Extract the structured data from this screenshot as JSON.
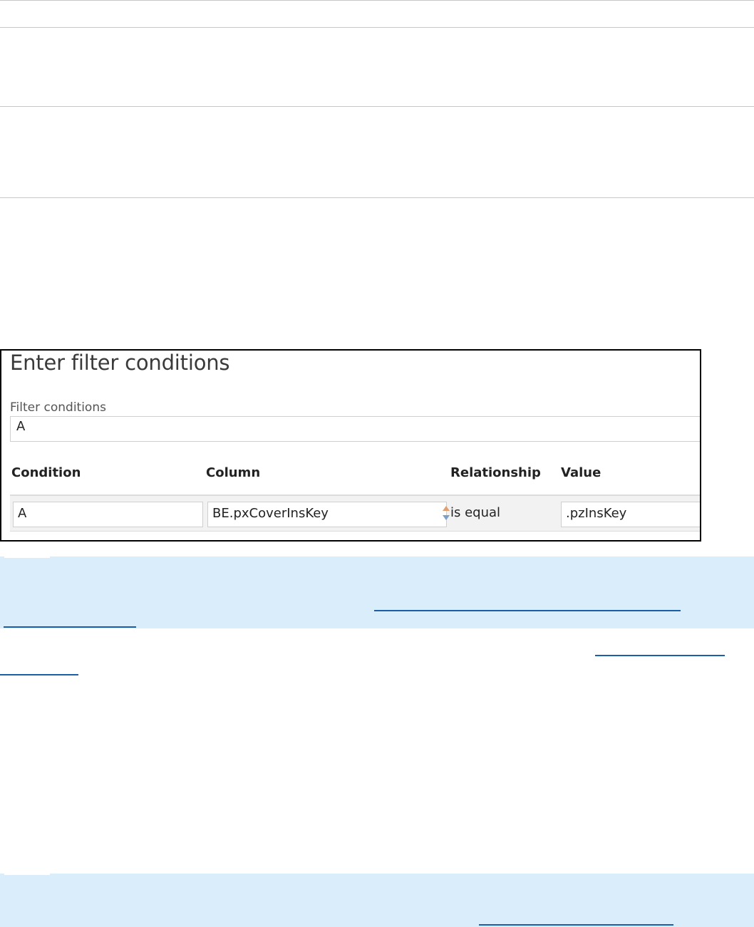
{
  "panel": {
    "title": "Enter filter conditions",
    "filter_conditions_label": "Filter conditions",
    "filter_conditions_value": "A",
    "columns": {
      "condition": "Condition",
      "column": "Column",
      "relationship": "Relationship",
      "value": "Value"
    },
    "row": {
      "condition": "A",
      "column": "BE.pxCoverInsKey",
      "relationship": "is equal",
      "value": ".pzInsKey"
    }
  },
  "colors": {
    "callout_background": "#d9eefa",
    "link": "#1a5fa8",
    "panel_border": "#000000",
    "sort_up_arrow": "#e0a070",
    "sort_down_arrow": "#7aa0c8"
  }
}
